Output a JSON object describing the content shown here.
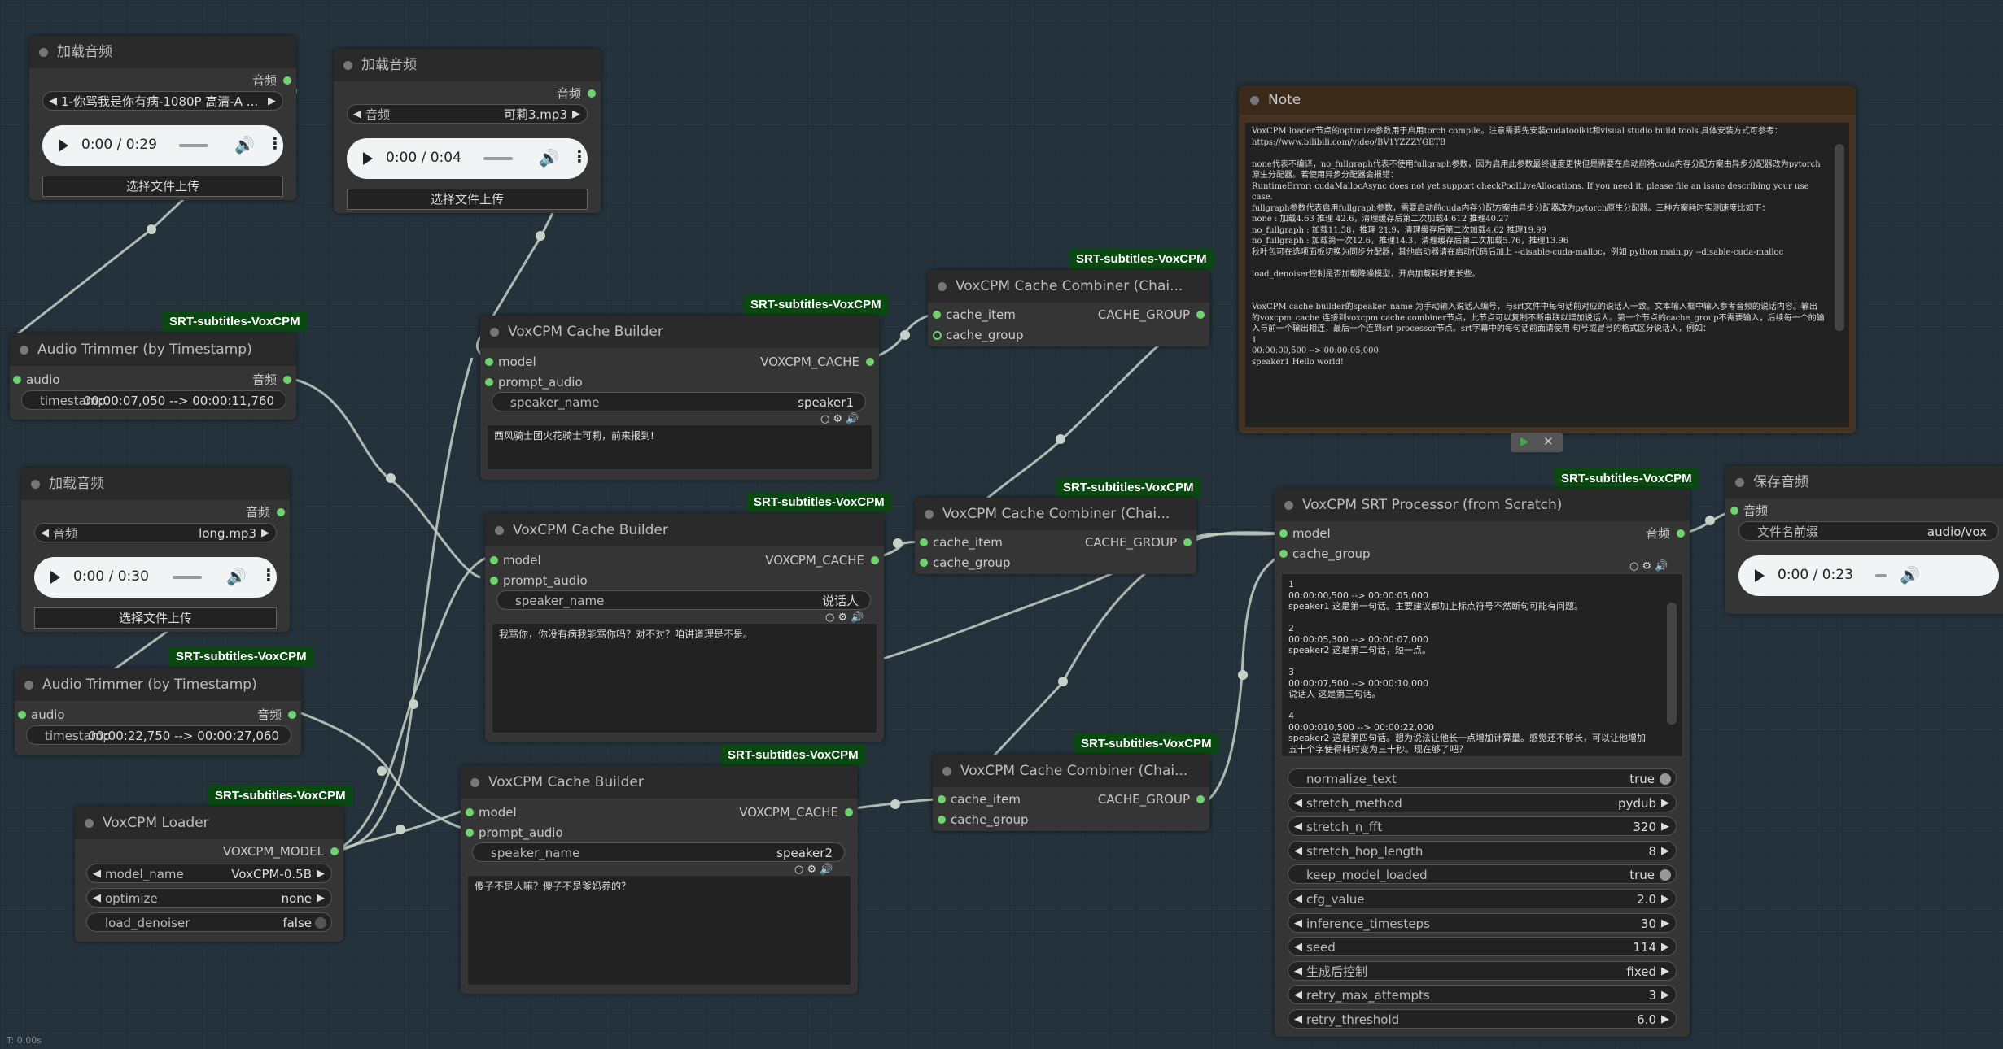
{
  "badge_text": "SRT-subtitles-VoxCPM",
  "load_audio_title": "加载音频",
  "audio_label": "音频",
  "upload_button": "选择文件上传",
  "load_audio_1": {
    "file": "1-你骂我是你有病-1080P 高清-A ...",
    "time": "0:00 / 0:29"
  },
  "load_audio_2": {
    "file": "可莉3.mp3",
    "time": "0:00 / 0:04"
  },
  "load_audio_3": {
    "file": "long.mp3",
    "time": "0:00 / 0:30"
  },
  "trimmer_title": "Audio Trimmer (by Timestamp)",
  "trimmer": {
    "in_audio": "audio",
    "out_audio": "音频",
    "timestamp_label": "timestamp"
  },
  "trimmer_1_timestamp": "00:00:07,050 --> 00:00:11,760",
  "trimmer_2_timestamp": "00:00:22,750 --> 00:00:27,060",
  "loader": {
    "title": "VoxCPM Loader",
    "output": "VOXCPM_MODEL",
    "model_name_label": "model_name",
    "model_name_value": "VoxCPM-0.5B",
    "optimize_label": "optimize",
    "optimize_value": "none",
    "load_denoiser_label": "load_denoiser",
    "load_denoiser_value": "false"
  },
  "builder_title": "VoxCPM Cache Builder",
  "builder": {
    "model": "model",
    "prompt_audio": "prompt_audio",
    "output": "VOXCPM_CACHE",
    "speaker_label": "speaker_name"
  },
  "builder_1": {
    "speaker": "speaker1",
    "text": "西风骑士团火花骑士可莉，前来报到!"
  },
  "builder_2": {
    "speaker": "说话人",
    "text": "我骂你，你没有病我能骂你吗？对不对？咱讲道理是不是。"
  },
  "builder_3": {
    "speaker": "speaker2",
    "text": "傻子不是人嘛？傻子不是爹妈养的？"
  },
  "combiner_title": "VoxCPM Cache Combiner (Chai...",
  "combiner": {
    "cache_item": "cache_item",
    "cache_group": "cache_group",
    "output": "CACHE_GROUP"
  },
  "note": {
    "title": "Note",
    "text": "VoxCPM loader节点的optimize参数用于启用torch compile。注意需要先安装cudatoolkit和visual studio build tools 具体安装方式可参考：\nhttps://www.bilibili.com/video/BV1YZZZYGETB\n\nnone代表不编译，no_fullgraph代表不使用fullgraph参数，因为启用此参数最终速度更快但是需要在启动前将cuda内存分配方案由异步分配器改为pytorch原生分配器。若使用异步分配器会报错：\nRuntimeError: cudaMallocAsync does not yet support checkPoolLiveAllocations. If you need it, please file an issue describing your use case.\nfullgraph参数代表启用fullgraph参数，需要启动前cuda内存分配方案由异步分配器改为pytorch原生分配器。三种方案耗时实测速度比如下：\nnone : 加载4.63 推理 42.6，清理缓存后第二次加载4.612 推理40.27\nno_fullgraph : 加载11.58，推理 21.9，清理缓存后第二次加载4.62 推理19.99\nno_fullgraph : 加载第一次12.6，推理14.3，清理缓存后第二次加载5.76，推理13.96\n秋叶包可在选项面板切换为同步分配器，其他启动器请在启动代码后加上 --disable-cuda-malloc，例如 python main.py --disable-cuda-malloc\n\nload_denoiser控制是否加载降噪模型，开启加载耗时更长些。\n\n\nVoxCPM cache builder的speaker_name 为手动输入说话人编号，与srt文件中每句话前对应的说话人一致。文本输入框中输入参考音频的说话内容。输出的voxcpm_cache 连接到voxcpm cache combiner节点，此节点可以复制不断串联以增加说话人。第一个节点的cache_group不需要输入，后续每一个的输入与前一个输出相连，最后一个连到srt processor节点。srt字幕中的每句话前面请使用 句号或冒号的格式区分说话人，例如：\n1\n00:00:00,500 --> 00:00:05,000\nspeaker1 Hello world!"
  },
  "processor": {
    "title": "VoxCPM SRT Processor (from Scratch)",
    "model": "model",
    "cache_group": "cache_group",
    "output": "音频",
    "srt_text": "1\n00:00:00,500 --> 00:00:05,000\nspeaker1 这是第一句话。主要建议都加上标点符号不然断句可能有问题。\n\n2\n00:00:05,300 --> 00:00:07,000\nspeaker2 这是第二句话，短一点。\n\n3\n00:00:07,500 --> 00:00:10,000\n说话人 这是第三句话。\n\n4\n00:00:010,500 --> 00:00:22,000\nspeaker2 这是第四句话。想为说法让他长一点增加计算量。感觉还不够长，可以让他增加五十个字使得耗时变为三十秒。现在够了吧？",
    "widgets": [
      {
        "label": "normalize_text",
        "value": "true",
        "type": "toggle"
      },
      {
        "label": "stretch_method",
        "value": "pydub",
        "type": "combo"
      },
      {
        "label": "stretch_n_fft",
        "value": "320",
        "type": "combo"
      },
      {
        "label": "stretch_hop_length",
        "value": "8",
        "type": "combo"
      },
      {
        "label": "keep_model_loaded",
        "value": "true",
        "type": "toggle"
      },
      {
        "label": "cfg_value",
        "value": "2.0",
        "type": "combo"
      },
      {
        "label": "inference_timesteps",
        "value": "30",
        "type": "combo"
      },
      {
        "label": "seed",
        "value": "114",
        "type": "combo"
      },
      {
        "label": "生成后控制",
        "value": "fixed",
        "type": "combo"
      },
      {
        "label": "retry_max_attempts",
        "value": "3",
        "type": "combo"
      },
      {
        "label": "retry_threshold",
        "value": "6.0",
        "type": "combo"
      }
    ]
  },
  "save": {
    "title": "保存音频",
    "audio": "音频",
    "prefix_label": "文件名前缀",
    "prefix_value": "audio/vox",
    "time": "0:00 / 0:23"
  },
  "footer": "T: 0.00s"
}
